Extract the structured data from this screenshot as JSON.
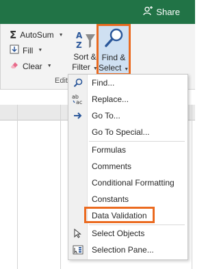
{
  "topbar": {
    "share_label": "Share"
  },
  "ribbon": {
    "autosum_label": "AutoSum",
    "fill_label": "Fill",
    "clear_label": "Clear",
    "sort_label_line1": "Sort &",
    "sort_label_line2": "Filter",
    "find_label_line1": "Find &",
    "find_label_line2": "Select",
    "group_label": "Edit"
  },
  "menu": {
    "items": [
      {
        "label": "Find...",
        "icon": "search-icon"
      },
      {
        "label": "Replace...",
        "icon": "replace-icon"
      },
      {
        "label": "Go To...",
        "icon": "arrow-right-icon"
      },
      {
        "label": "Go To Special...",
        "icon": ""
      },
      {
        "label": "Formulas",
        "icon": ""
      },
      {
        "label": "Comments",
        "icon": ""
      },
      {
        "label": "Conditional Formatting",
        "icon": ""
      },
      {
        "label": "Constants",
        "icon": ""
      },
      {
        "label": "Data Validation",
        "icon": ""
      },
      {
        "label": "Select Objects",
        "icon": "cursor-icon"
      },
      {
        "label": "Selection Pane...",
        "icon": "selection-pane-icon"
      }
    ]
  },
  "colors": {
    "excel_green": "#217346",
    "highlight_orange": "#eb6a1f",
    "ribbon_bg": "#f3f3f3",
    "icon_blue": "#2b579a"
  }
}
